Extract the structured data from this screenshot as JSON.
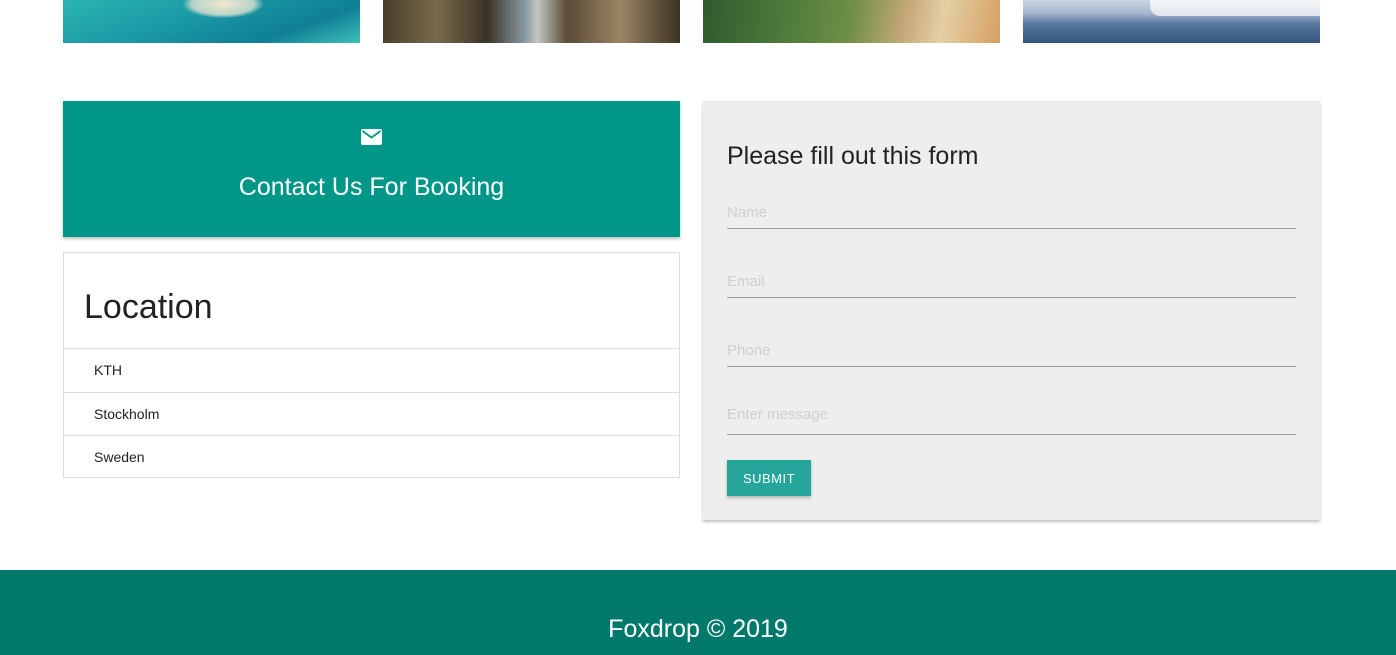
{
  "gallery": {
    "photos": [
      "turquoise-sea-island-photo",
      "narrow-alley-photo",
      "green-cliffs-photo",
      "ferry-on-sea-photo"
    ]
  },
  "contact": {
    "icon": "mail-icon",
    "title": "Contact Us For Booking",
    "accent_color": "#009688"
  },
  "location": {
    "title": "Location",
    "items": [
      "KTH",
      "Stockholm",
      "Sweden"
    ]
  },
  "form": {
    "title": "Please fill out this form",
    "name_placeholder": "Name",
    "email_placeholder": "Email",
    "phone_placeholder": "Phone",
    "message_placeholder": "Enter message",
    "submit_label": "SUBMIT",
    "button_color": "#26a69a"
  },
  "footer": {
    "text": "Foxdrop © 2019",
    "color": "#00796b"
  }
}
